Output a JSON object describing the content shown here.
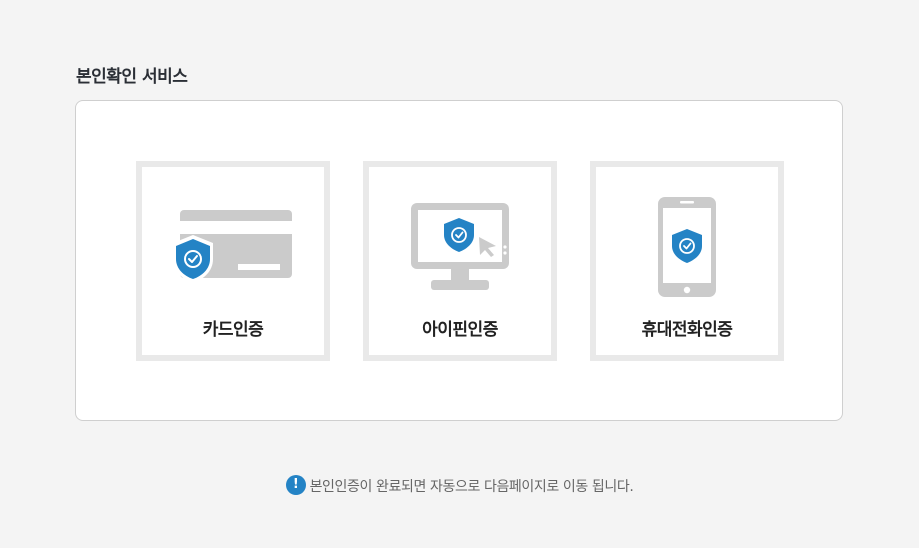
{
  "page": {
    "title": "본인확인 서비스"
  },
  "options": [
    {
      "id": "card",
      "label": "카드인증",
      "icon": "credit-card-shield-icon"
    },
    {
      "id": "ipin",
      "label": "아이핀인증",
      "icon": "monitor-shield-icon"
    },
    {
      "id": "phone",
      "label": "휴대전화인증",
      "icon": "phone-shield-icon"
    }
  ],
  "notice": {
    "icon": "exclamation-icon",
    "icon_glyph": "!",
    "text": "본인인증이 완료되면 자동으로 다음페이지로 이동 됩니다."
  },
  "colors": {
    "accent": "#2483c5",
    "illustration_gray": "#cbcbcb",
    "card_border": "#e9e9e9"
  }
}
